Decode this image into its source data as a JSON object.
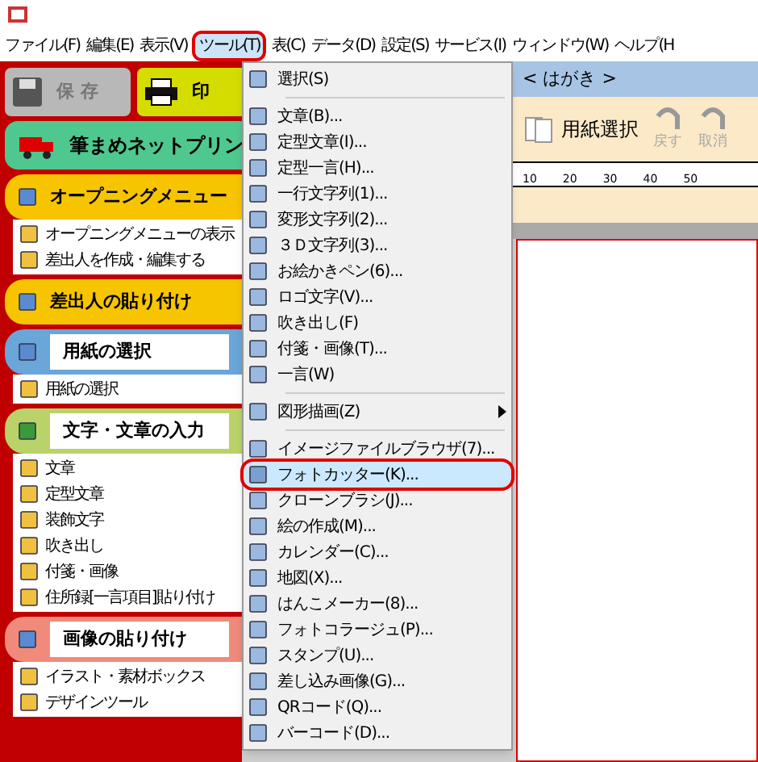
{
  "menu_bar": [
    {
      "label": "ファイル(F)",
      "selected": false
    },
    {
      "label": "編集(E)",
      "selected": false
    },
    {
      "label": "表示(V)",
      "selected": false
    },
    {
      "label": "ツール(T)",
      "selected": true
    },
    {
      "label": "表(C)",
      "selected": false
    },
    {
      "label": "データ(D)",
      "selected": false
    },
    {
      "label": "設定(S)",
      "selected": false
    },
    {
      "label": "サービス(I)",
      "selected": false
    },
    {
      "label": "ウィンドウ(W)",
      "selected": false
    },
    {
      "label": "ヘルプ(H",
      "selected": false
    }
  ],
  "sidebar": {
    "save_button": "保 存",
    "print_button": "印",
    "net_print": "筆まめネットプリン",
    "sections": [
      {
        "kind": "tab",
        "title": "オープニングメニュー",
        "color": "#f7c400",
        "items": [
          "オープニングメニューの表示",
          "差出人を作成・編集する"
        ]
      },
      {
        "kind": "tab",
        "title": "差出人の貼り付け",
        "color": "#f7c400"
      },
      {
        "kind": "boxed",
        "title": "用紙の選択",
        "color": "#6aa6d8",
        "items": [
          "用紙の選択"
        ]
      },
      {
        "kind": "boxed",
        "title": "文字・文章の入力",
        "color": "#b9d36a",
        "items": [
          "文章",
          "定型文章",
          "装飾文字",
          "吹き出し",
          "付箋・画像",
          "住所録[一言項目]貼り付け"
        ]
      },
      {
        "kind": "boxed",
        "title": "画像の貼り付け",
        "color": "#f08a7a",
        "items": [
          "イラスト・素材ボックス",
          "デザインツール"
        ]
      }
    ]
  },
  "document_tab": "< はがき >",
  "toolbar": [
    {
      "label": "用紙選択",
      "disabled": false
    },
    {
      "label": "戻す",
      "disabled": true
    },
    {
      "label": "取消",
      "disabled": true
    }
  ],
  "ruler": [
    "10",
    "20",
    "30",
    "40",
    "50"
  ],
  "tools_menu": [
    {
      "kind": "item",
      "label": "選択(S)",
      "selected": false
    },
    {
      "kind": "separator"
    },
    {
      "kind": "item",
      "label": "文章(B)...",
      "selected": false
    },
    {
      "kind": "item",
      "label": "定型文章(I)...",
      "selected": false
    },
    {
      "kind": "item",
      "label": "定型一言(H)...",
      "selected": false
    },
    {
      "kind": "item",
      "label": "一行文字列(1)...",
      "selected": false
    },
    {
      "kind": "item",
      "label": "変形文字列(2)...",
      "selected": false
    },
    {
      "kind": "item",
      "label": "３Ｄ文字列(3)...",
      "selected": false
    },
    {
      "kind": "item",
      "label": "お絵かきペン(6)...",
      "selected": false
    },
    {
      "kind": "item",
      "label": "ロゴ文字(V)...",
      "selected": false
    },
    {
      "kind": "item",
      "label": "吹き出し(F)",
      "selected": false
    },
    {
      "kind": "item",
      "label": "付箋・画像(T)...",
      "selected": false
    },
    {
      "kind": "item",
      "label": "一言(W)",
      "selected": false
    },
    {
      "kind": "separator"
    },
    {
      "kind": "submenu",
      "label": "図形描画(Z)",
      "selected": false
    },
    {
      "kind": "separator"
    },
    {
      "kind": "item",
      "label": "イメージファイルブラウザ(7)...",
      "selected": false
    },
    {
      "kind": "item",
      "label": "フォトカッター(K)...",
      "selected": true
    },
    {
      "kind": "item",
      "label": "クローンブラシ(J)...",
      "selected": false
    },
    {
      "kind": "item",
      "label": "絵の作成(M)...",
      "selected": false
    },
    {
      "kind": "item",
      "label": "カレンダー(C)...",
      "selected": false
    },
    {
      "kind": "item",
      "label": "地図(X)...",
      "selected": false
    },
    {
      "kind": "item",
      "label": "はんこメーカー(8)...",
      "selected": false
    },
    {
      "kind": "item",
      "label": "フォトコラージュ(P)...",
      "selected": false
    },
    {
      "kind": "item",
      "label": "スタンプ(U)...",
      "selected": false
    },
    {
      "kind": "item",
      "label": "差し込み画像(G)...",
      "selected": false
    },
    {
      "kind": "item",
      "label": "QRコード(Q)...",
      "selected": false
    },
    {
      "kind": "item",
      "label": "バーコード(D)...",
      "selected": false
    }
  ]
}
